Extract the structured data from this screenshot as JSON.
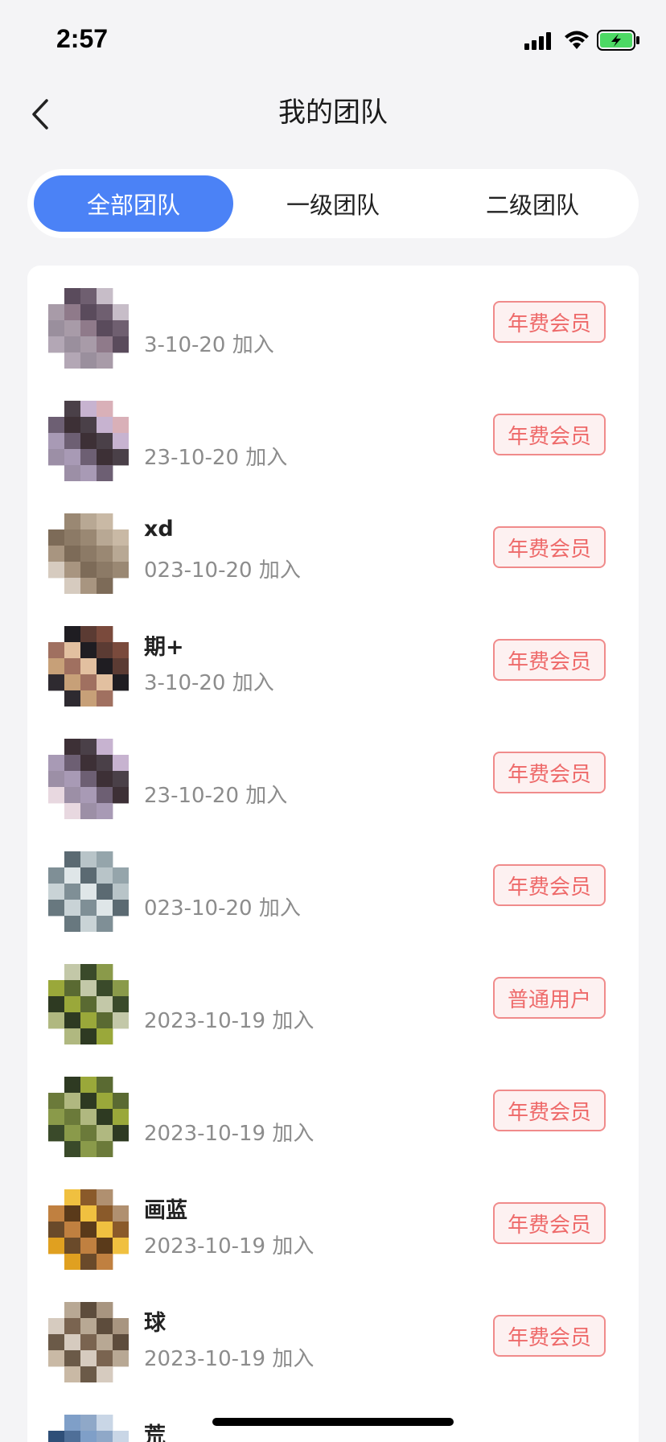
{
  "status_bar": {
    "time": "2:57",
    "icons": [
      "signal-icon",
      "wifi-icon",
      "battery-charging-icon"
    ],
    "battery_color": "#4cd964"
  },
  "header": {
    "back_icon": "chevron-left-icon",
    "title": "我的团队"
  },
  "tabs": [
    {
      "label": "全部团队",
      "active": true
    },
    {
      "label": "一级团队",
      "active": false
    },
    {
      "label": "二级团队",
      "active": false
    }
  ],
  "colors": {
    "accent": "#4b82f6",
    "badge_text": "#ee6a6a",
    "badge_border": "#f08b8b",
    "badge_bg": "#fdf1f1"
  },
  "join_suffix": "加入",
  "members": [
    {
      "name": "",
      "date": "3-10-20",
      "badge": "年费会员"
    },
    {
      "name": "",
      "date": "23-10-20",
      "badge": "年费会员"
    },
    {
      "name": "xd",
      "date": "023-10-20",
      "badge": "年费会员"
    },
    {
      "name": "期+",
      "date": "3-10-20",
      "badge": "年费会员"
    },
    {
      "name": "",
      "date": "23-10-20",
      "badge": "年费会员"
    },
    {
      "name": "",
      "date": "023-10-20",
      "badge": "年费会员"
    },
    {
      "name": "",
      "date": "2023-10-19",
      "badge": "普通用户"
    },
    {
      "name": "",
      "date": "2023-10-19",
      "badge": "年费会员"
    },
    {
      "name": "画蓝",
      "date": "2023-10-19",
      "badge": "年费会员"
    },
    {
      "name": "球",
      "date": "2023-10-19",
      "badge": "年费会员"
    },
    {
      "name": "荒",
      "date": "",
      "badge": ""
    }
  ]
}
